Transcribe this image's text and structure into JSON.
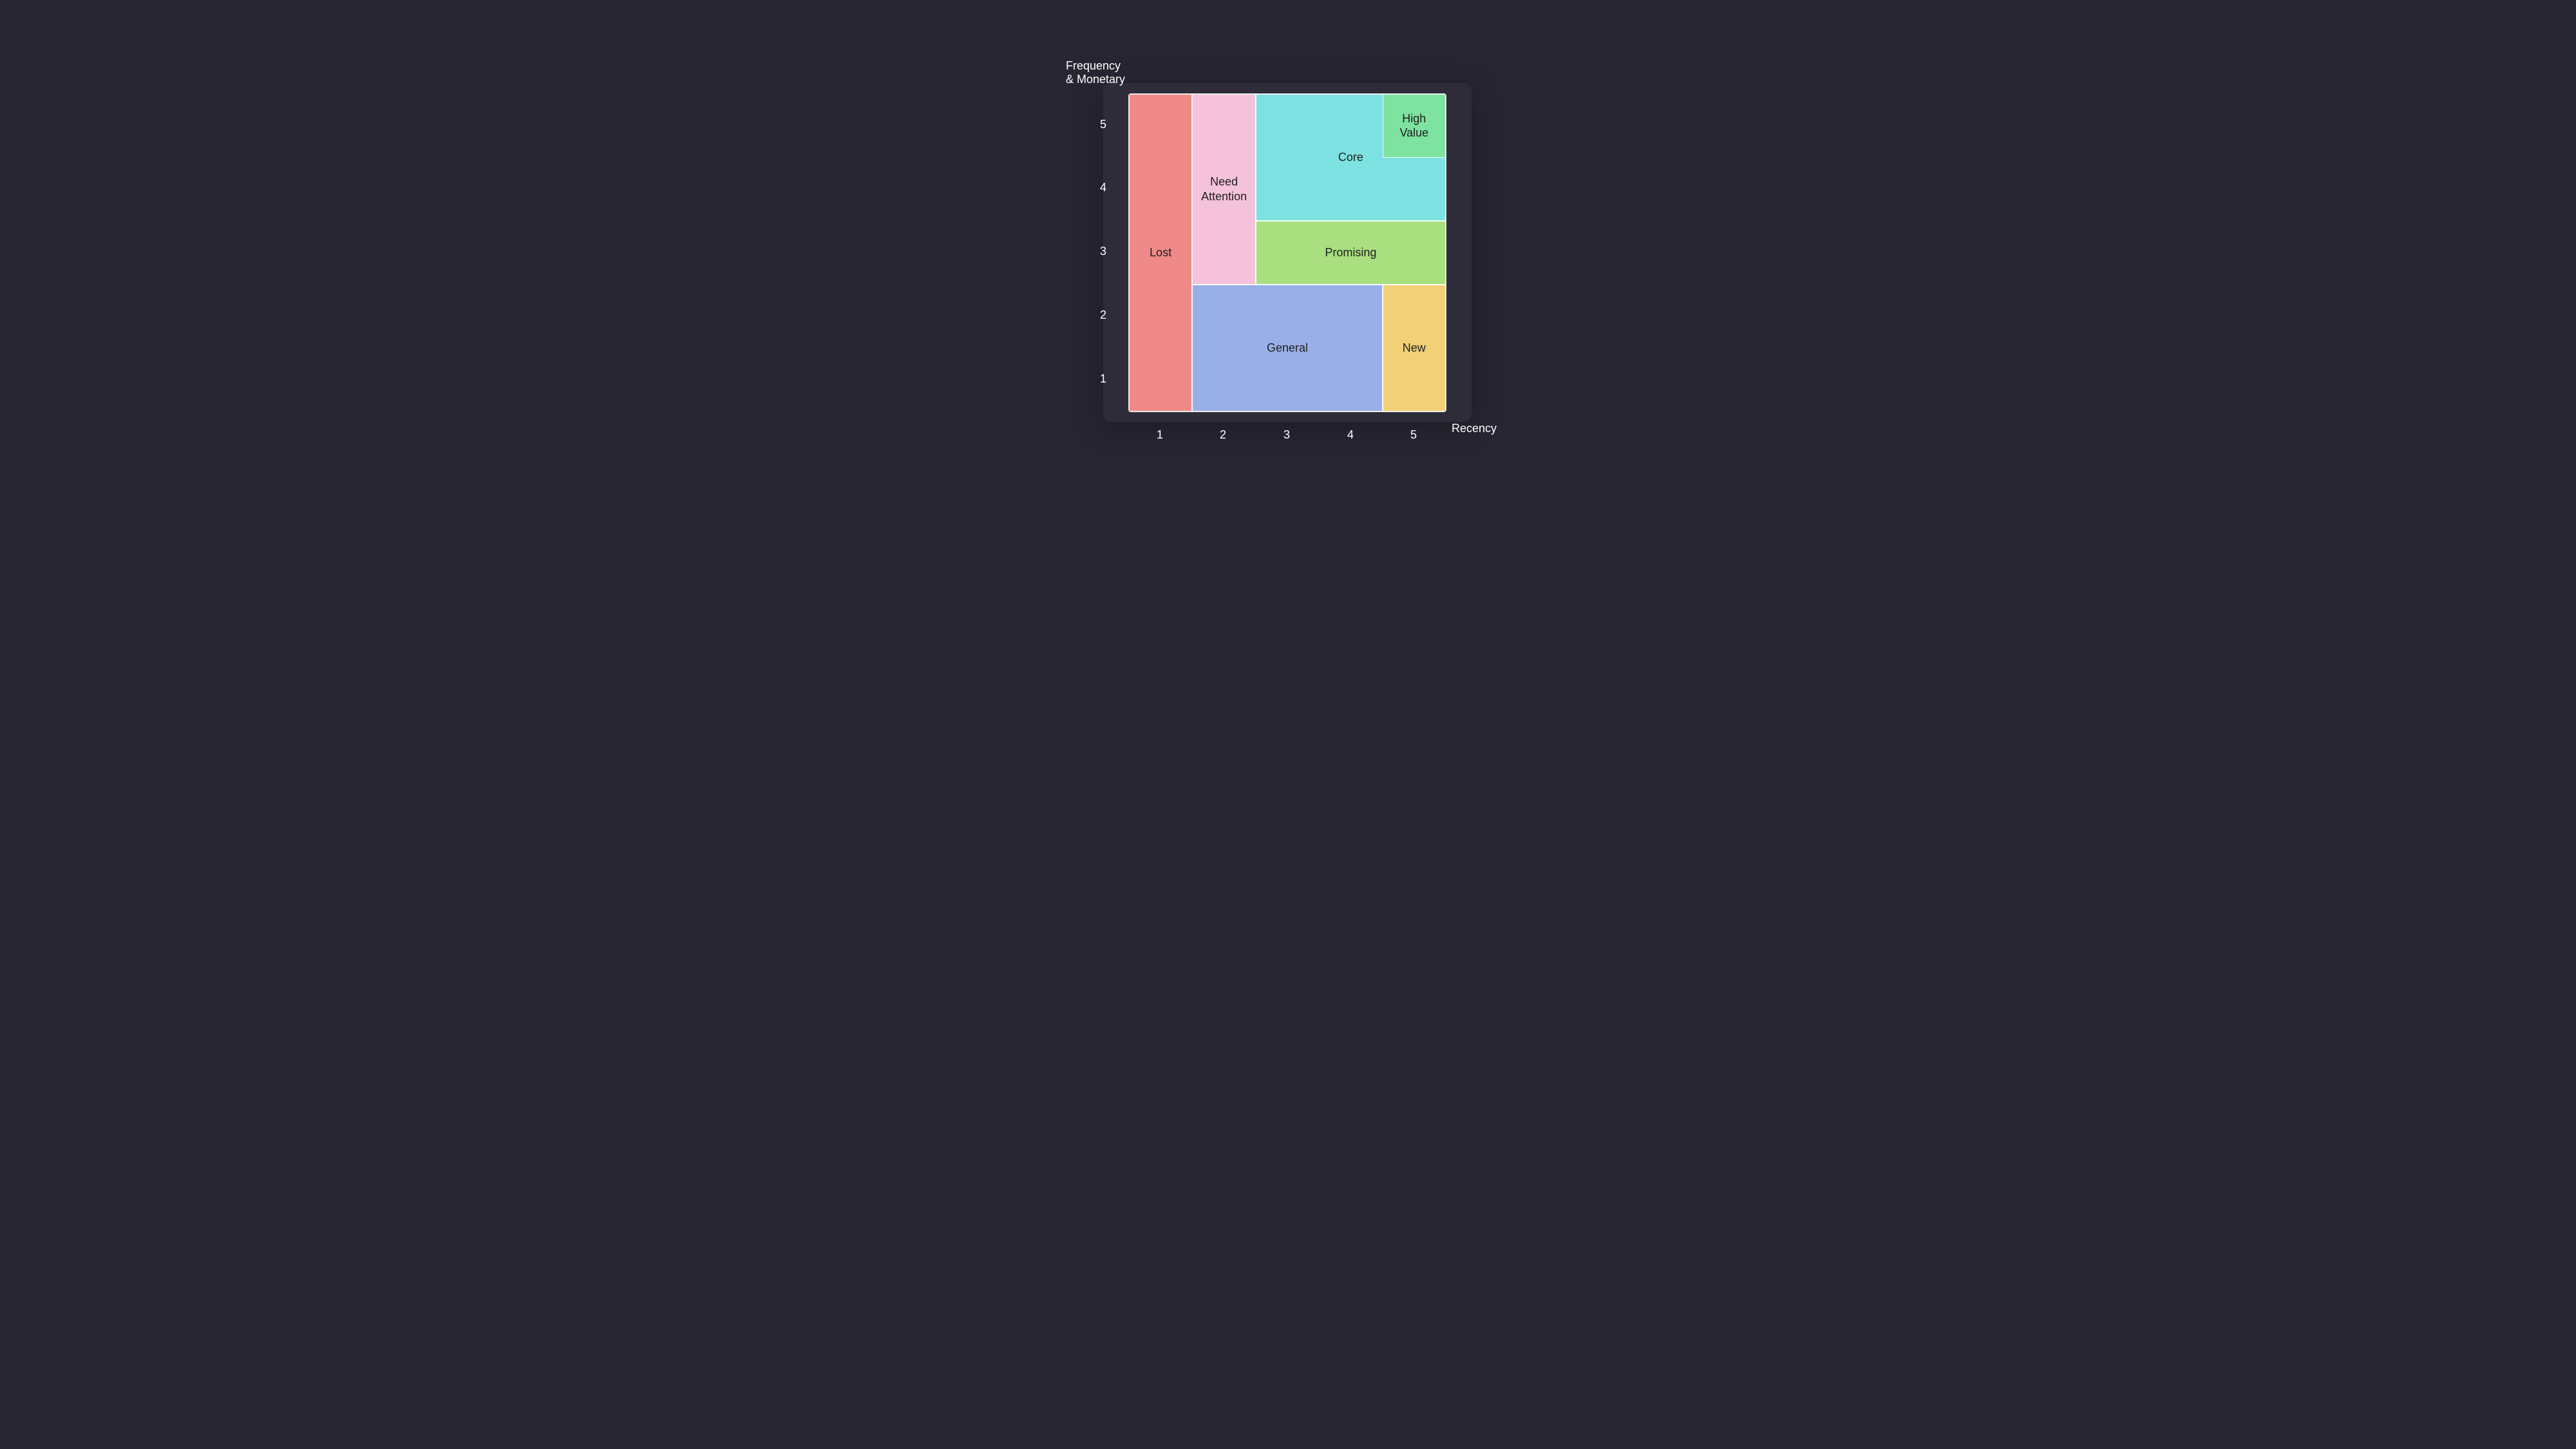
{
  "axes": {
    "y_title": "Frequency\n& Monetary",
    "x_title": "Recency",
    "x_ticks": [
      "1",
      "2",
      "3",
      "4",
      "5"
    ],
    "y_ticks": [
      "5",
      "4",
      "3",
      "2",
      "1"
    ]
  },
  "segments": {
    "lost": {
      "label": "Lost",
      "color": "#ef8a89"
    },
    "need_attention": {
      "label": "Need\nAttention",
      "color": "#f4c2da"
    },
    "core": {
      "label": "Core",
      "color": "#7de1e1"
    },
    "high_value": {
      "label": "High\nValue",
      "color": "#7ee2a0"
    },
    "promising": {
      "label": "Promising",
      "color": "#a9df7f"
    },
    "general": {
      "label": "General",
      "color": "#99afe8"
    },
    "new": {
      "label": "New",
      "color": "#f1d077"
    }
  },
  "chart_data": {
    "type": "heatmap",
    "title": "",
    "xlabel": "Recency",
    "ylabel": "Frequency & Monetary",
    "x_categories": [
      1,
      2,
      3,
      4,
      5
    ],
    "y_categories": [
      1,
      2,
      3,
      4,
      5
    ],
    "segments": [
      {
        "name": "Lost",
        "recency": [
          1,
          1
        ],
        "fm": [
          1,
          5
        ]
      },
      {
        "name": "Need Attention",
        "recency": [
          2,
          2
        ],
        "fm": [
          3,
          5
        ]
      },
      {
        "name": "Core",
        "recency": [
          3,
          5
        ],
        "fm": [
          4,
          5
        ]
      },
      {
        "name": "High Value",
        "recency": [
          5,
          5
        ],
        "fm": [
          5,
          5
        ]
      },
      {
        "name": "Promising",
        "recency": [
          3,
          5
        ],
        "fm": [
          3,
          3
        ]
      },
      {
        "name": "General",
        "recency": [
          2,
          4
        ],
        "fm": [
          1,
          2
        ]
      },
      {
        "name": "New",
        "recency": [
          5,
          5
        ],
        "fm": [
          1,
          2
        ]
      }
    ]
  }
}
